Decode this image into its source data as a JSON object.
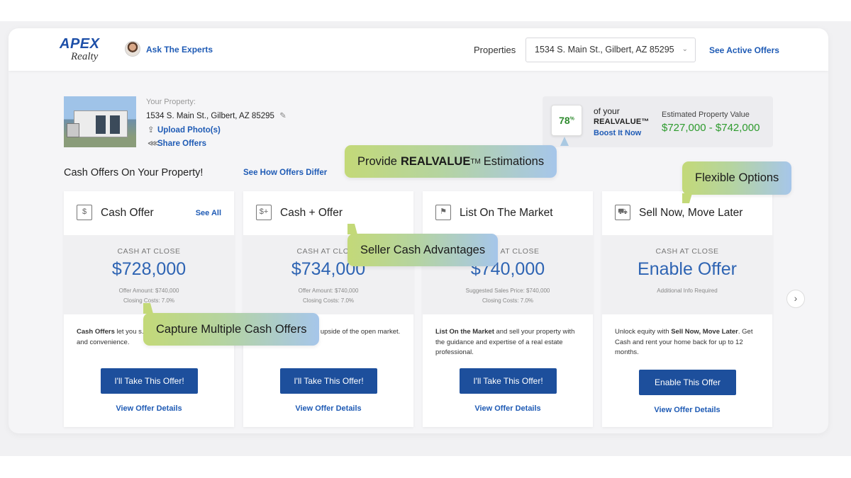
{
  "header": {
    "logo_top": "APEX",
    "logo_bottom": "Realty",
    "ask_experts": "Ask The Experts",
    "properties_label": "Properties",
    "property_select_value": "1534 S. Main St., Gilbert, AZ 85295",
    "see_active_offers": "See Active Offers"
  },
  "property": {
    "label": "Your Property:",
    "address": "1534 S. Main St., Gilbert, AZ 85295",
    "upload": "Upload Photo(s)",
    "share": "Share Offers"
  },
  "realvalue": {
    "percent": "78",
    "percent_sign": "%",
    "of_your": "of your",
    "name": "REALVALUE™",
    "boost": "Boost It Now",
    "estimate_label": "Estimated Property Value",
    "estimate_value": "$727,000 - $742,000"
  },
  "section": {
    "title": "Cash Offers On Your Property!",
    "see_how": "See How Offers Differ"
  },
  "cards": [
    {
      "title": "Cash Offer",
      "see_all": "See All",
      "cash_label": "CASH AT CLOSE",
      "amount": "$728,000",
      "detail1": "Offer Amount: $740,000",
      "detail2": "Closing Costs: 7.0%",
      "desc_bold": "Cash Offers",
      "desc_rest": " let you s... listing your property, ... and convenience.",
      "button": "I'll Take This Offer!",
      "details_link": "View Offer Details"
    },
    {
      "title": "Cash + Offer",
      "cash_label": "CASH AT CLOSE",
      "amount": "$734,000",
      "detail1": "Offer Amount: $740,000",
      "detail2": "Closing Costs: 7.0%",
      "desc_rest": "... all of the benefit ... upside of the open market.",
      "button": "I'll Take This Offer!",
      "details_link": "View Offer Details"
    },
    {
      "title": "List On The Market",
      "cash_label": "CASH AT CLOSE",
      "amount": "$740,000",
      "detail1": "Suggested Sales Price: $740,000",
      "detail2": "Closing Costs: 7.0%",
      "desc_bold": "List On the Market",
      "desc_rest": " and sell your property with the guidance and expertise of a real estate professional.",
      "button": "I'll Take This Offer!",
      "details_link": "View Offer Details"
    },
    {
      "title": "Sell Now, Move Later",
      "cash_label": "CASH AT CLOSE",
      "amount": "Enable Offer",
      "detail1": "Additional Info Required",
      "desc_pre": "Unlock equity with ",
      "desc_bold": "Sell Now, Move Later",
      "desc_rest": ". Get Cash and rent your home back for up to 12 months.",
      "button": "Enable This Offer",
      "details_link": "View Offer Details"
    }
  ],
  "callouts": {
    "realvalue_pre": "Provide",
    "realvalue_bold": "REALVALUE",
    "realvalue_tm": "TM",
    "realvalue_post": "Estimations",
    "flexible": "Flexible Options",
    "seller_cash": "Seller Cash Advantages",
    "capture": "Capture Multiple Cash Offers"
  },
  "icons": [
    "pencil-icon",
    "upload-icon",
    "share-icon",
    "chevron-down-icon",
    "chevron-right-icon",
    "cash-offer-icon",
    "cash-plus-icon",
    "list-market-icon",
    "truck-icon"
  ],
  "colors": {
    "brand_blue": "#1d4f9c",
    "link_blue": "#1f5bb5",
    "value_green": "#2e9b2e",
    "logo_orange": "#f0a53a"
  }
}
